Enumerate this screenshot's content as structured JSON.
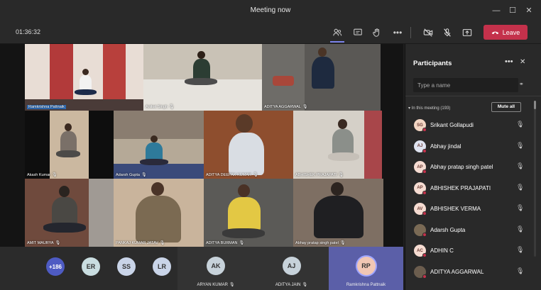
{
  "window": {
    "title": "Meeting now"
  },
  "toolbar": {
    "timer": "01:36:32",
    "leave_label": "Leave"
  },
  "tiles": [
    {
      "name": "Ramkrishna Pattnaik"
    },
    {
      "name": "Aniket Singh"
    },
    {
      "name": "ADITYA AGGARWAL"
    },
    {
      "name": "Akash Kumar"
    },
    {
      "name": "Adarsh Gupta"
    },
    {
      "name": "ADITYA DEEPAK KUMAR"
    },
    {
      "name": "ABHISHEK PRAJAPATI"
    },
    {
      "name": "AMIT MAURYA"
    },
    {
      "name": "PANKAJ KUMAR JATAV"
    },
    {
      "name": "ADITYA BURMAN"
    },
    {
      "name": "Abhay pratap singh patel"
    }
  ],
  "strip": {
    "overflow": "+186",
    "avatars": [
      "ER",
      "SS",
      "LR"
    ],
    "tiles": [
      {
        "initials": "AK",
        "name": "ARYAN KUMAR"
      },
      {
        "initials": "AJ",
        "name": "ADITYA JAIN"
      },
      {
        "initials": "RP",
        "name": "Ramkrishna Pattnaik"
      }
    ]
  },
  "panel": {
    "title": "Participants",
    "search_placeholder": "Type a name",
    "section": "In this meeting (193)",
    "mute_all": "Mute all",
    "participants": [
      {
        "initials": "SG",
        "name": "Srikant Gollapudi",
        "color": "#f3d6c4"
      },
      {
        "initials": "AJ",
        "name": "Abhay jindal",
        "color": "#dfe3f0"
      },
      {
        "initials": "AP",
        "name": "Abhay pratap singh patel",
        "color": "#f6dcd2"
      },
      {
        "initials": "AP",
        "name": "ABHISHEK PRAJAPATI",
        "color": "#f6dcd2"
      },
      {
        "initials": "AV",
        "name": "ABHISHEK VERMA",
        "color": "#f6dcd2"
      },
      {
        "initials": "",
        "name": "Adarsh Gupta",
        "color": "#7a6a55"
      },
      {
        "initials": "AC",
        "name": "ADHIN C",
        "color": "#f6dcd2"
      },
      {
        "initials": "",
        "name": "ADITYA AGGARWAL",
        "color": "#6b5d4e"
      }
    ]
  }
}
